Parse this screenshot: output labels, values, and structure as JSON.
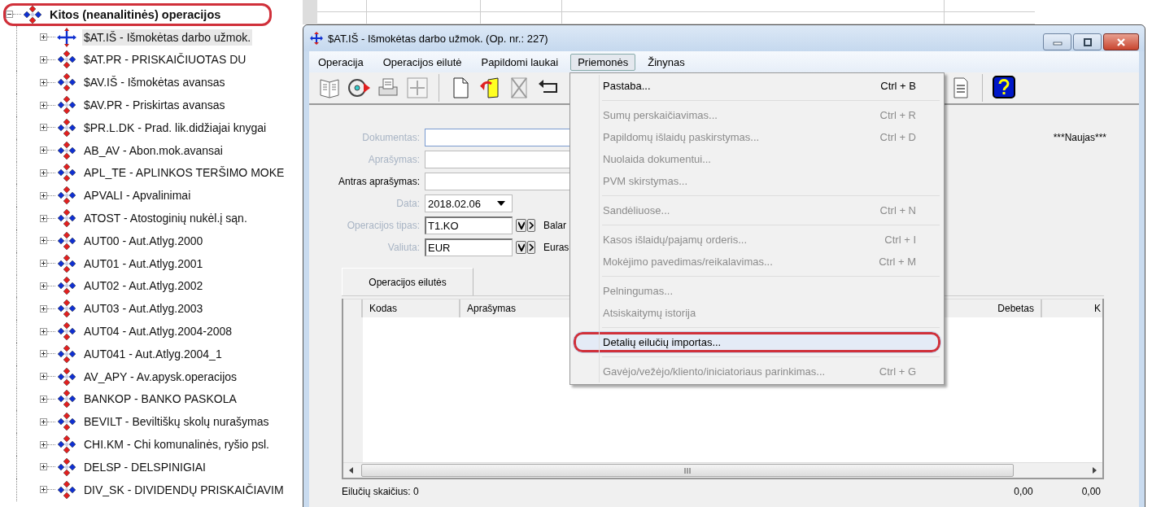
{
  "tree": {
    "label": "Kitos (neanalitinės) operacijos",
    "expanded": true,
    "selected": false,
    "annotated": true,
    "children": [
      {
        "label": "$AT.IŠ - Išmokėtas darbo užmok.",
        "expanded": false,
        "selected": true
      },
      {
        "label": "$AT.PR - PRISKAIČIUOTAS DU",
        "expanded": false,
        "selected": false
      },
      {
        "label": "$AV.IŠ - Išmokėtas avansas",
        "expanded": false,
        "selected": false
      },
      {
        "label": "$AV.PR - Priskirtas avansas",
        "expanded": false,
        "selected": false
      },
      {
        "label": "$PR.L.DK - Prad. lik.didžiajai knygai",
        "expanded": false,
        "selected": false
      },
      {
        "label": "AB_AV - Abon.mok.avansai",
        "expanded": false,
        "selected": false
      },
      {
        "label": "APL_TE - APLINKOS TERŠIMO MOKE",
        "expanded": false,
        "selected": false
      },
      {
        "label": "APVALI - Apvalinimai",
        "expanded": false,
        "selected": false
      },
      {
        "label": "ATOST - Atostoginių nukėl.į sąn.",
        "expanded": false,
        "selected": false
      },
      {
        "label": "AUT00 - Aut.Atlyg.2000",
        "expanded": false,
        "selected": false
      },
      {
        "label": "AUT01 - Aut.Atlyg.2001",
        "expanded": false,
        "selected": false
      },
      {
        "label": "AUT02 - Aut.Atlyg.2002",
        "expanded": false,
        "selected": false
      },
      {
        "label": "AUT03 - Aut.Atlyg.2003",
        "expanded": false,
        "selected": false
      },
      {
        "label": "AUT04 - Aut.Atlyg.2004-2008",
        "expanded": false,
        "selected": false
      },
      {
        "label": "AUT041 - Aut.Atlyg.2004_1",
        "expanded": false,
        "selected": false
      },
      {
        "label": "AV_APY - Av.apysk.operacijos",
        "expanded": false,
        "selected": false
      },
      {
        "label": "BANKOP - BANKO PASKOLA",
        "expanded": false,
        "selected": false
      },
      {
        "label": "BEVILT - Beviltiškų skolų nurašymas",
        "expanded": false,
        "selected": false
      },
      {
        "label": "CHI.KM - Chi komunalinės, ryšio psl.",
        "expanded": false,
        "selected": false
      },
      {
        "label": "DELSP - DELSPINIGIAI",
        "expanded": false,
        "selected": false
      },
      {
        "label": "DIV_SK - DIVIDENDŲ PRISKAIČIAVIM",
        "expanded": false,
        "selected": false
      }
    ]
  },
  "dialog": {
    "title": "$AT.IŠ - Išmokėtas darbo užmok. (Op. nr.: 227)",
    "menu": [
      {
        "label": "Operacija",
        "selected": false
      },
      {
        "label": "Operacijos eilutė",
        "selected": false
      },
      {
        "label": "Papildomi laukai",
        "selected": false
      },
      {
        "label": "Priemonės",
        "selected": true
      },
      {
        "label": "Žinynas",
        "selected": false
      }
    ],
    "fields": [
      {
        "label": "Dokumentas:",
        "kind": "text",
        "disabled": true,
        "focused": true
      },
      {
        "label": "Aprašymas:",
        "kind": "text",
        "disabled": true,
        "focused": false
      },
      {
        "label": "Antras aprašymas:",
        "kind": "text",
        "disabled": false,
        "focused": false
      },
      {
        "label": "Data:",
        "kind": "date",
        "value": "2018.02.06",
        "disabled": true
      },
      {
        "label": "Operacijos tipas:",
        "kind": "lookup",
        "value": "T1.KO",
        "note": "Balar",
        "disabled": true
      },
      {
        "label": "Valiuta:",
        "kind": "lookup",
        "value": "EUR",
        "note": "Euras",
        "disabled": true
      }
    ],
    "status": "***Naujas***",
    "tabs": [
      {
        "label": "Operacijos eilutės",
        "selected": true
      }
    ],
    "grid": {
      "columns": [
        "Kodas",
        "Aprašymas",
        "Debetas",
        "K"
      ]
    },
    "row_count": "Eilučių skaičius: 0",
    "totals": [
      "0,00",
      "0,00"
    ],
    "dropdown": [
      {
        "kind": "item",
        "label": "Pastaba...",
        "shortcut": "Ctrl + B",
        "disabled": false,
        "selected": false,
        "annotated": false
      },
      {
        "kind": "separator"
      },
      {
        "kind": "item",
        "label": "Sumų perskaičiavimas...",
        "shortcut": "Ctrl + R",
        "disabled": true,
        "selected": false,
        "annotated": false
      },
      {
        "kind": "item",
        "label": "Papildomų išlaidų paskirstymas...",
        "shortcut": "Ctrl + D",
        "disabled": true,
        "selected": false,
        "annotated": false
      },
      {
        "kind": "item",
        "label": "Nuolaida dokumentui...",
        "disabled": true,
        "selected": false,
        "annotated": false
      },
      {
        "kind": "item",
        "label": "PVM skirstymas...",
        "disabled": true,
        "selected": false,
        "annotated": false
      },
      {
        "kind": "separator"
      },
      {
        "kind": "item",
        "label": "Sandėliuose...",
        "shortcut": "Ctrl + N",
        "disabled": true,
        "selected": false,
        "annotated": false
      },
      {
        "kind": "separator"
      },
      {
        "kind": "item",
        "label": "Kasos išlaidų/pajamų orderis...",
        "shortcut": "Ctrl + I",
        "disabled": true,
        "selected": false,
        "annotated": false
      },
      {
        "kind": "item",
        "label": "Mokėjimo pavedimas/reikalavimas...",
        "shortcut": "Ctrl + M",
        "disabled": true,
        "selected": false,
        "annotated": false
      },
      {
        "kind": "separator"
      },
      {
        "kind": "item",
        "label": "Pelningumas...",
        "disabled": true,
        "selected": false,
        "annotated": false
      },
      {
        "kind": "item",
        "label": "Atsiskaitymų istorija",
        "disabled": true,
        "selected": false,
        "annotated": false
      },
      {
        "kind": "separator"
      },
      {
        "kind": "item",
        "label": "Detalių eilučių importas...",
        "disabled": false,
        "selected": true,
        "annotated": true
      },
      {
        "kind": "separator"
      },
      {
        "kind": "item",
        "label": "Gavėjo/vežėjo/kliento/iniciatoriaus parinkimas...",
        "shortcut": "Ctrl + G",
        "disabled": true,
        "selected": false,
        "annotated": false
      }
    ]
  }
}
